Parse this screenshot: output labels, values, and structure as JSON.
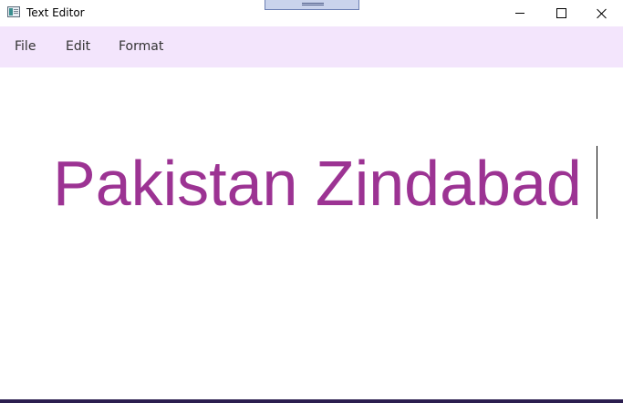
{
  "window": {
    "title": "Text Editor",
    "app_icon": "text-editor-app-icon",
    "controls": {
      "minimize_icon": "minimize-icon",
      "maximize_icon": "maximize-icon",
      "close_icon": "close-icon"
    }
  },
  "menubar": {
    "background": "#f3e5fc",
    "items": [
      {
        "label": "File"
      },
      {
        "label": "Edit"
      },
      {
        "label": "Format"
      }
    ]
  },
  "editor": {
    "content": "Pakistan Zindabad",
    "text_color": "#9c3393",
    "caret_visible": true
  }
}
